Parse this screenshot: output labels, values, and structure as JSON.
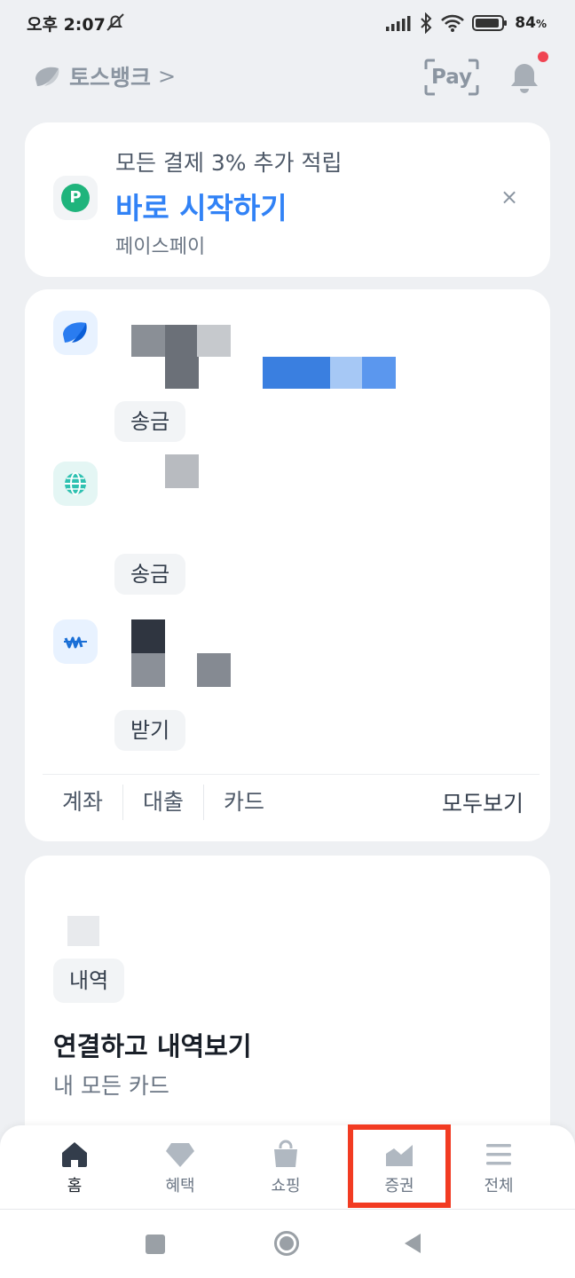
{
  "status_bar": {
    "time": "오후 2:07",
    "battery_percent": "84",
    "battery_unit": "%",
    "icons": [
      "bell-off-icon",
      "signal-icon",
      "bluetooth-icon",
      "wifi-icon",
      "battery-icon"
    ]
  },
  "header": {
    "brand": "토스뱅크",
    "chevron": ">",
    "pay_label": "Pay",
    "notification_dot_color": "#f04452"
  },
  "promo": {
    "icon_letter": "P",
    "subtitle": "모든 결제 3% 추가 적립",
    "title": "바로 시작하기",
    "source": "페이스페이",
    "close": "×",
    "accent_color": "#3182f6"
  },
  "accounts": {
    "items": [
      {
        "icon": "toss-logo-icon",
        "button": "송금"
      },
      {
        "icon": "globe-icon",
        "button": "송금"
      },
      {
        "icon": "won-icon",
        "button": "받기"
      }
    ],
    "tabs": [
      "계좌",
      "대출",
      "카드"
    ],
    "view_all": "모두보기"
  },
  "cards_section": {
    "tag": "내역",
    "title": "연결하고 내역보기",
    "subtitle": "내 모든 카드"
  },
  "tab_bar": {
    "items": [
      {
        "label": "홈",
        "icon": "home-icon",
        "active": true
      },
      {
        "label": "혜택",
        "icon": "diamond-icon",
        "active": false
      },
      {
        "label": "쇼핑",
        "icon": "shopping-bag-icon",
        "active": false
      },
      {
        "label": "증권",
        "icon": "stock-chart-icon",
        "active": false,
        "highlighted": true
      },
      {
        "label": "전체",
        "icon": "menu-icon",
        "active": false
      }
    ],
    "highlight_color": "#f23b22"
  },
  "system_nav": {
    "icons": [
      "recent-apps-icon",
      "home-circle-icon",
      "back-icon"
    ]
  }
}
